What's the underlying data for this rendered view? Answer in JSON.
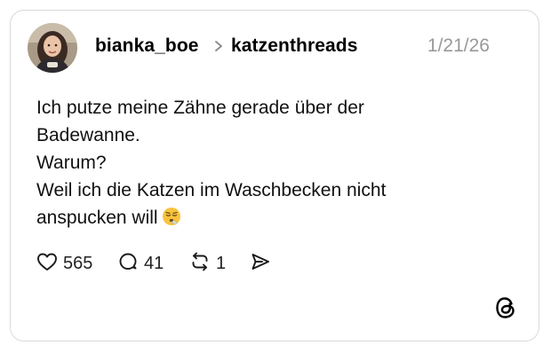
{
  "post": {
    "username": "bianka_boe",
    "community": "katzenthreads",
    "date": "1/21/26",
    "text_lines": [
      "Ich putze meine Zähne gerade über der",
      "Badewanne.",
      "Warum?",
      "Weil ich die Katzen im Waschbecken nicht",
      "anspucken will"
    ],
    "emoji": "sighing-face-emoji"
  },
  "actions": {
    "likes": "565",
    "replies": "41",
    "reposts": "1"
  },
  "icons": {
    "separator": "chevron-right-icon",
    "like": "heart-icon",
    "reply": "speech-bubble-icon",
    "repost": "repost-icon",
    "share": "send-icon",
    "brand": "threads-logo-icon"
  },
  "colors": {
    "border": "#d9d9d9",
    "date": "#999999",
    "text": "#111111"
  }
}
